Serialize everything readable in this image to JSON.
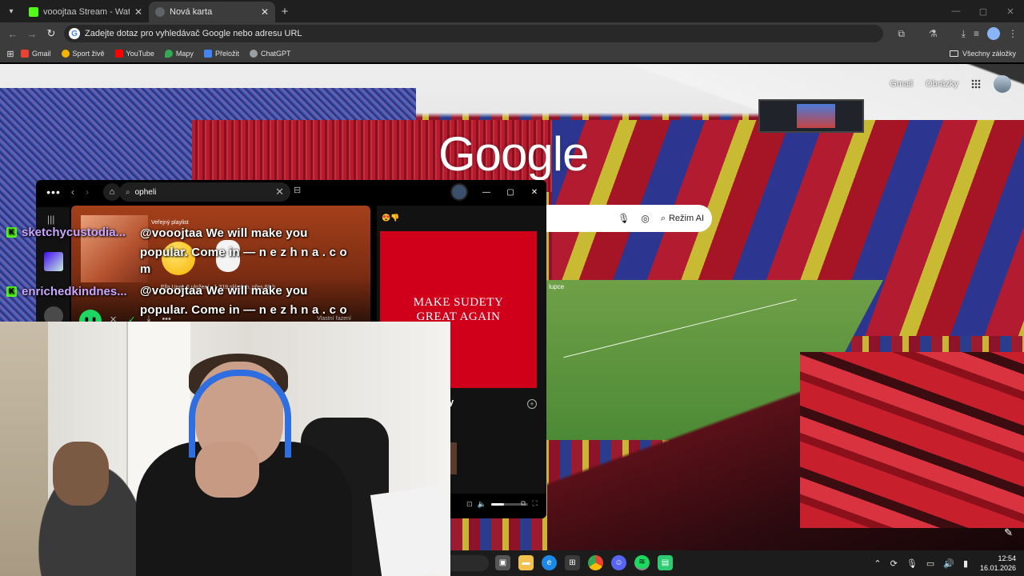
{
  "browser": {
    "tabs": [
      {
        "title": "vooojtaa Stream - Watch Live o",
        "favicon_color": "#53fc18",
        "active": false
      },
      {
        "title": "Nová karta",
        "favicon_color": "#5f6368",
        "active": true
      }
    ],
    "new_tab_symbol": "+",
    "omnibox": {
      "placeholder": "Zadejte dotaz pro vyhledávač Google nebo adresu URL"
    },
    "bookmarks": [
      {
        "label": "Gmail",
        "color": "#ea4335"
      },
      {
        "label": "Sport živě",
        "color": "#f4b400"
      },
      {
        "label": "YouTube",
        "color": "#ff0000"
      },
      {
        "label": "Mapy",
        "color": "#34a853"
      },
      {
        "label": "Přeložit",
        "color": "#4285f4"
      },
      {
        "label": "ChatGPT",
        "color": "#9aa0a6"
      }
    ],
    "all_bookmarks": "Všechny záložky"
  },
  "ntp": {
    "logo": "Google",
    "top_links": {
      "gmail": "Gmail",
      "images": "Obrázky"
    },
    "ai_mode": "Režim AI",
    "pitch_caption": "lupce"
  },
  "spotify": {
    "search_value": "opheli",
    "playlist_type": "Veřejný playlist",
    "playlist_meta": "Ella Ungl, 6 uložení · 1 319 skladeb, přes 60 h",
    "sort_label": "Vlastní řazení",
    "now_playing_poster": "MAKE SUDETY GREAT AGAIN",
    "now_playing_title": "y"
  },
  "chat": {
    "messages": [
      {
        "user": "sketchycustodia...",
        "text_line1": "@vooojtaa We will make you",
        "text_line2": "popular. Come in — n e z h n a . c o",
        "text_line3": "m"
      },
      {
        "user": "enrichedkindnes...",
        "text_line1": "@vooojtaa We will make you",
        "text_line2": "popular. Come in — n e z h n a . c o"
      }
    ],
    "badge": "K",
    "username_color": "#c9a6ff"
  },
  "taskbar": {
    "time": "12:54",
    "date": "16.01.2026"
  }
}
